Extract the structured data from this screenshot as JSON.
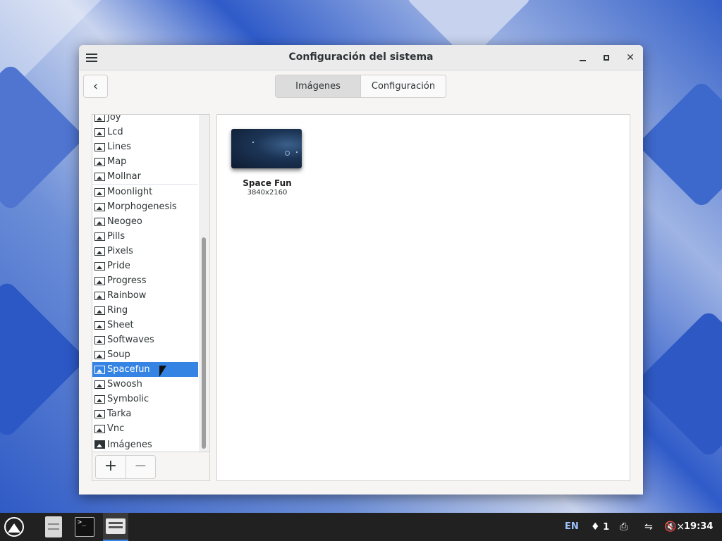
{
  "window": {
    "title": "Configuración del sistema",
    "menu_icon": "hamburger-menu-icon",
    "controls": [
      "minimize-icon",
      "maximize-icon",
      "close-icon"
    ]
  },
  "toolbar": {
    "back_icon": "chevron-left-icon",
    "tabs": [
      {
        "label": "Imágenes",
        "active": true
      },
      {
        "label": "Configuración",
        "active": false
      }
    ]
  },
  "sidebar": {
    "items": [
      {
        "label": "Joy"
      },
      {
        "label": "Lcd"
      },
      {
        "label": "Lines"
      },
      {
        "label": "Map"
      },
      {
        "label": "Mollnar"
      },
      {
        "label": "Moonlight"
      },
      {
        "label": "Morphogenesis"
      },
      {
        "label": "Neogeo"
      },
      {
        "label": "Pills"
      },
      {
        "label": "Pixels"
      },
      {
        "label": "Pride"
      },
      {
        "label": "Progress"
      },
      {
        "label": "Rainbow"
      },
      {
        "label": "Ring"
      },
      {
        "label": "Sheet"
      },
      {
        "label": "Softwaves"
      },
      {
        "label": "Soup"
      },
      {
        "label": "Spacefun",
        "selected": true
      },
      {
        "label": "Swoosh"
      },
      {
        "label": "Symbolic"
      },
      {
        "label": "Tarka"
      },
      {
        "label": "Vnc"
      }
    ],
    "folder_label": "Imágenes",
    "add_label": "+",
    "remove_label": "−"
  },
  "content": {
    "wallpapers": [
      {
        "name": "Space Fun",
        "resolution": "3840x2160"
      }
    ]
  },
  "taskbar": {
    "keyboard_layout": "EN",
    "notifications_count": "1",
    "clock": "19:34",
    "accent_color": "#3584e4"
  }
}
